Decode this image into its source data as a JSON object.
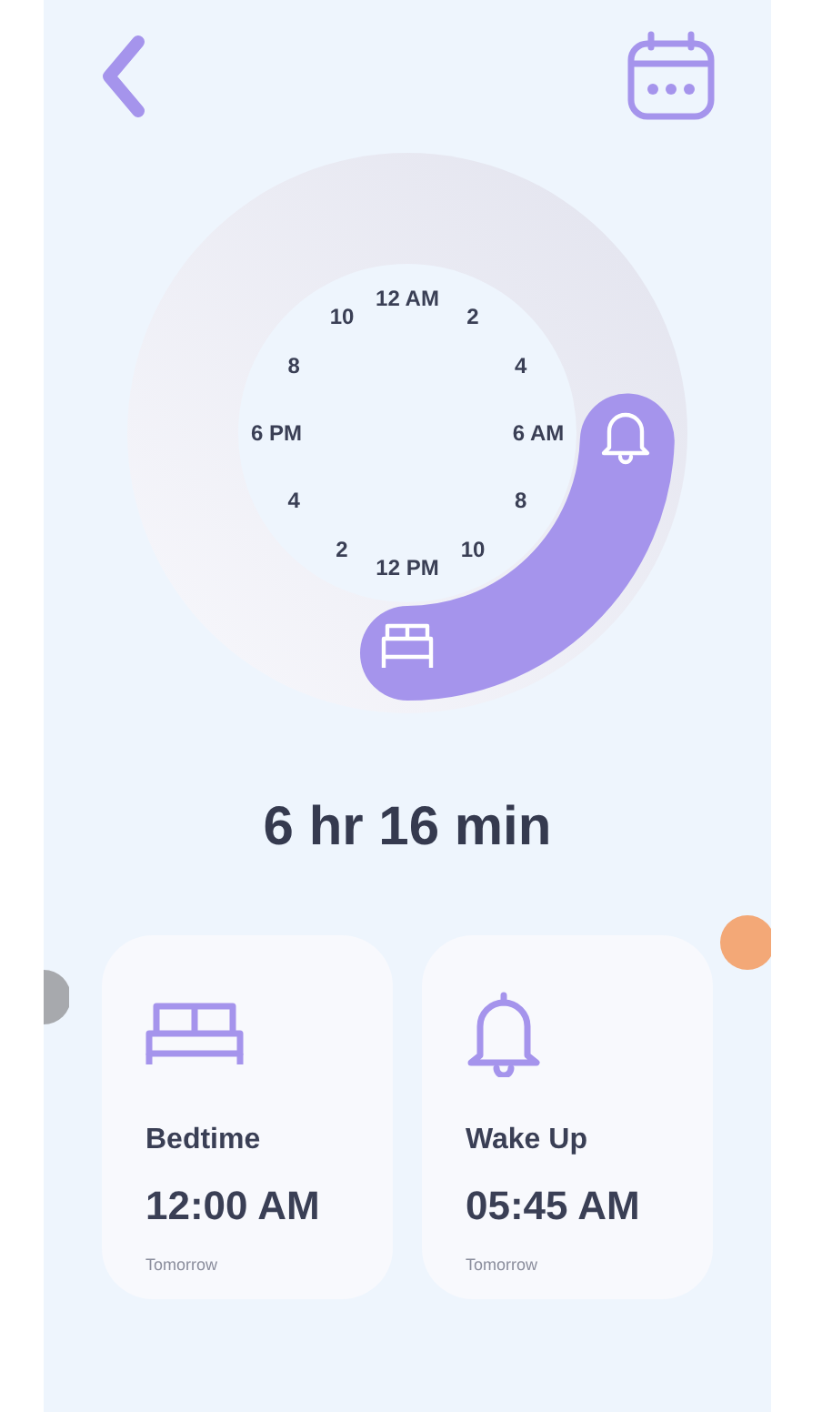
{
  "dial": {
    "label_rows": [
      [
        "12 AM"
      ],
      [
        "10",
        "2"
      ],
      [
        "8",
        "4"
      ],
      [
        "6 PM",
        "6 AM"
      ],
      [
        "4",
        "8"
      ],
      [
        "2",
        "10"
      ],
      [
        "12 PM"
      ]
    ]
  },
  "duration": "6 hr 16 min",
  "cards": [
    {
      "kind": "bedtime",
      "label": "Bedtime",
      "time": "12:00 AM",
      "day": "Tomorrow"
    },
    {
      "kind": "wake",
      "label": "Wake Up",
      "time": "05:45 AM",
      "day": "Tomorrow"
    }
  ]
}
